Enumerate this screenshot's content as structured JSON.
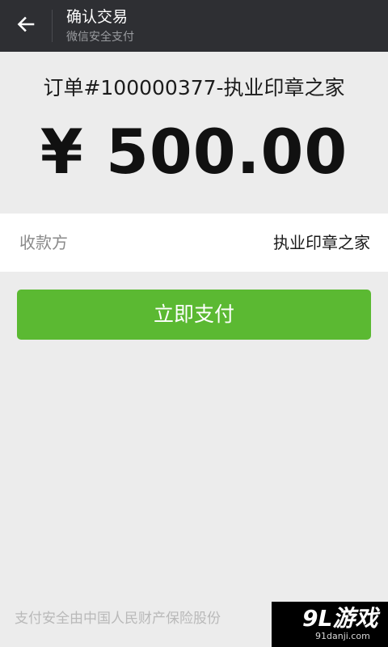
{
  "header": {
    "back_icon": "arrow-left-icon",
    "title": "确认交易",
    "subtitle": "微信安全支付"
  },
  "order": {
    "title": "订单#100000377-执业印章之家",
    "amount": "¥ 500.00"
  },
  "payee": {
    "label": "收款方",
    "value": "执业印章之家"
  },
  "pay_button": {
    "label": "立即支付",
    "color": "#5bb932"
  },
  "footer": {
    "text": "支付安全由中国人民财产保险股份"
  },
  "watermark": {
    "logo": "9L游戏",
    "url": "91danji.com"
  },
  "colors": {
    "header_bg": "#2e2f33",
    "page_bg": "#ececec",
    "accent_green": "#5bb932"
  }
}
